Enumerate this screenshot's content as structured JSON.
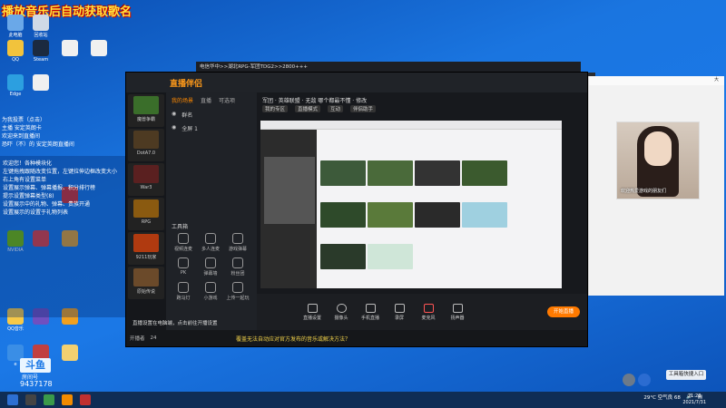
{
  "overlay": {
    "title": "播放音乐后自动获取歌名",
    "chatlog": [
      "为我投票（点击）",
      "主播 安定英朗卡",
      "欢迎来到直播间",
      "恐吓（不）的 安定英朗直播间"
    ],
    "notes": [
      "欢迎您！各种模块化",
      "左键拖拽跟随改变位置，左键拉伸边框改变大小",
      "右上角有设置菜单",
      "设置展示弹幕、弹幕播报、积分排行榜",
      "提示设置弹幕类型(8)",
      "设置展示中的礼物、弹幕、贵族开通",
      "设置展示的设置于礼物列表"
    ]
  },
  "desktop_icons": [
    {
      "label": "此电脑",
      "color": "#6aa8e8"
    },
    {
      "label": "回收站",
      "color": "#cfd9e6"
    },
    {
      "label": "QQ",
      "color": "#f2c33c"
    },
    {
      "label": "Steam",
      "color": "#1b2a40"
    },
    {
      "label": "",
      "color": "#f0f0f0"
    },
    {
      "label": "",
      "color": "#f0f0f0"
    },
    {
      "label": "Edge",
      "color": "#2c9fe0"
    },
    {
      "label": "",
      "color": "#f0f0f0"
    },
    {
      "label": "NVIDIA",
      "color": "#76b900"
    },
    {
      "label": "",
      "color": "#e04040"
    },
    {
      "label": "",
      "color": "#e0a030"
    },
    {
      "label": "",
      "color": "#d03030"
    },
    {
      "label": "QQ音乐",
      "color": "#f7c948"
    },
    {
      "label": "",
      "color": "#7050c0"
    },
    {
      "label": "",
      "color": "#f0a020"
    },
    {
      "label": "e",
      "color": "#3a8ee6"
    },
    {
      "label": "",
      "color": "#c04040"
    },
    {
      "label": "",
      "color": "#f3d070"
    }
  ],
  "titlebar": "电信华中>>湖北RPG-军团TDG2>>2800+++",
  "app": {
    "logo": "直播伴侣",
    "tabs": [
      "我的场景",
      "直播",
      "可选项"
    ],
    "scenes": [
      "群名",
      "全屏 1"
    ],
    "tools_title": "工具箱",
    "tools": [
      "视频连麦",
      "多人连麦",
      "游戏弹幕",
      "PK",
      "弹幕墙",
      "粉丝团",
      "跑马灯",
      "小游戏",
      "上传一起玩"
    ],
    "info_line": "军团 · 英雄联盟 · 无敌 哪个都最不懂 · 修改",
    "info_pills": [
      "我的专区",
      "直播模式",
      "互动",
      "伴侣助手"
    ],
    "controls": [
      "直播设置",
      "摄像头",
      "手机直播",
      "录屏",
      "麦克风",
      "扬声器"
    ],
    "start_label": "开始直播",
    "footer_user": "开播者",
    "footer_count": "24",
    "warn": "直播设置在电脑端，点击前往开播设置"
  },
  "game_tiles": [
    {
      "label": "魔兽争霸",
      "color": "#3a6e2a"
    },
    {
      "label": "DotA7.0",
      "color": "#4d3a22"
    },
    {
      "label": "War3",
      "color": "#5a2020"
    },
    {
      "label": "RPG",
      "color": "#8a5a10"
    },
    {
      "label": "9211玩家",
      "color": "#b03a10"
    },
    {
      "label": "原始传说",
      "color": "#6b4a2a"
    }
  ],
  "notice": "覆盖无法自动应对官方发布的音乐或解决方法？",
  "chat_window": {
    "corner_text": "大",
    "portrait_caption": "欢迎热爱游戏的朋友们"
  },
  "toast_button": "工具箱快捷入口",
  "bottom_logo": {
    "brand": "斗鱼",
    "sub": "房间号",
    "id": "9437178"
  },
  "taskbar": {
    "weather": "29°C 空气良 68",
    "time": "21:28",
    "date": "2021/7/31"
  },
  "colors": {
    "accent": "#ff7a00",
    "desktop": "#1b78e6",
    "overlay_title": "#ffe23d"
  }
}
